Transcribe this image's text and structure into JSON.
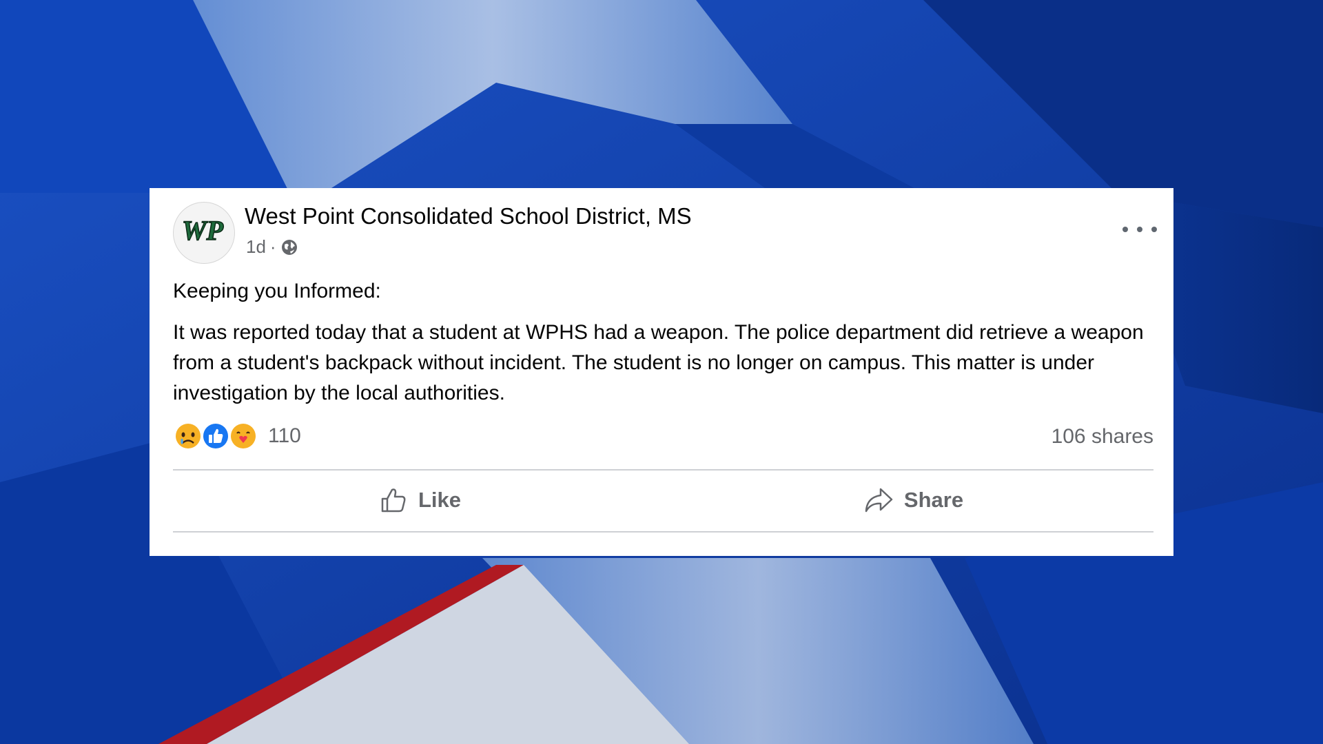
{
  "post": {
    "page_name": "West Point Consolidated School District, MS",
    "avatar_text": "WP",
    "time": "1d",
    "separator": "·",
    "audience_icon": "globe-icon",
    "more_icon": "more-options-icon",
    "paragraphs": [
      "Keeping you Informed:",
      "It was reported today that a student at WPHS had a weapon. The police department did retrieve a weapon from a student's backpack without incident. The student is no longer on campus. This matter is under investigation by the local authorities."
    ],
    "reactions": [
      "sad-reaction-icon",
      "like-reaction-icon",
      "care-reaction-icon"
    ],
    "reaction_count": "110",
    "shares": "106 shares",
    "actions": {
      "like_label": "Like",
      "share_label": "Share"
    }
  },
  "colors": {
    "background_blue": "#0b3ea8",
    "card": "#ffffff",
    "secondary_text": "#65676b",
    "like_blue": "#1877f2",
    "avatar_green": "#1e6b3c"
  }
}
